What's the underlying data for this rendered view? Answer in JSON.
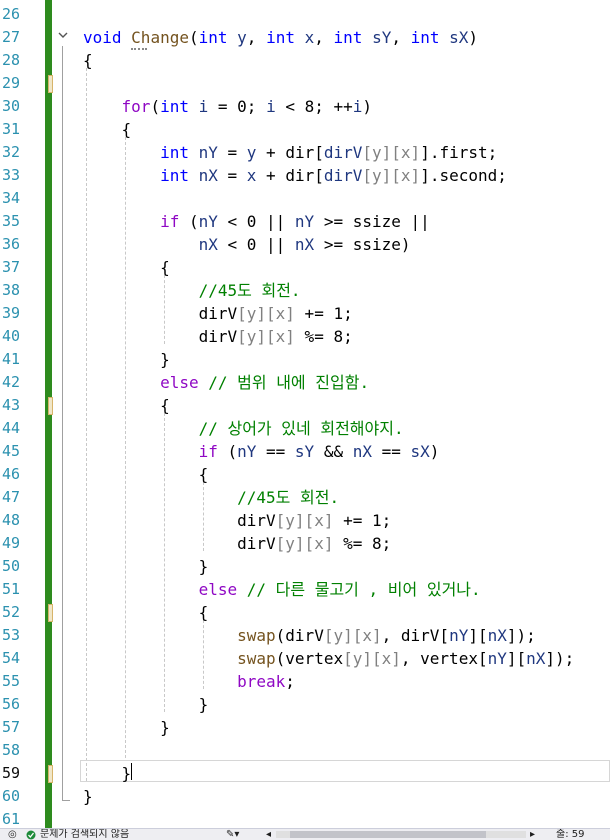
{
  "editor": {
    "current_line": "59",
    "lines": [
      {
        "num": "26",
        "segs": []
      },
      {
        "num": "27",
        "segs": [
          [
            "kw",
            "void"
          ],
          [
            "",
            " "
          ],
          [
            "fn",
            "Change"
          ],
          [
            "",
            "("
          ],
          [
            "kw",
            "int"
          ],
          [
            "",
            " "
          ],
          [
            "id",
            "y"
          ],
          [
            "",
            ", "
          ],
          [
            "kw",
            "int"
          ],
          [
            "",
            " "
          ],
          [
            "id",
            "x"
          ],
          [
            "",
            ", "
          ],
          [
            "kw",
            "int"
          ],
          [
            "",
            " "
          ],
          [
            "id",
            "sY"
          ],
          [
            "",
            ", "
          ],
          [
            "kw",
            "int"
          ],
          [
            "",
            " "
          ],
          [
            "id",
            "sX"
          ],
          [
            "",
            ")"
          ]
        ]
      },
      {
        "num": "28",
        "segs": [
          [
            "",
            "{"
          ]
        ]
      },
      {
        "num": "29",
        "segs": []
      },
      {
        "num": "30",
        "segs": [
          [
            "",
            "    "
          ],
          [
            "ctl",
            "for"
          ],
          [
            "",
            "("
          ],
          [
            "kw",
            "int"
          ],
          [
            "",
            " "
          ],
          [
            "id",
            "i"
          ],
          [
            "",
            " = 0; "
          ],
          [
            "id",
            "i"
          ],
          [
            "",
            " < 8; ++"
          ],
          [
            "id",
            "i"
          ],
          [
            "",
            ")"
          ]
        ]
      },
      {
        "num": "31",
        "segs": [
          [
            "",
            "    {"
          ]
        ]
      },
      {
        "num": "32",
        "segs": [
          [
            "",
            "        "
          ],
          [
            "kw",
            "int"
          ],
          [
            "",
            " "
          ],
          [
            "id",
            "nY"
          ],
          [
            "",
            " = "
          ],
          [
            "id",
            "y"
          ],
          [
            "",
            " + dir["
          ],
          [
            "id",
            "dirV"
          ],
          [
            "pr",
            "[y][x]"
          ],
          [
            "",
            "].first;"
          ]
        ]
      },
      {
        "num": "33",
        "segs": [
          [
            "",
            "        "
          ],
          [
            "kw",
            "int"
          ],
          [
            "",
            " "
          ],
          [
            "id",
            "nX"
          ],
          [
            "",
            " = "
          ],
          [
            "id",
            "x"
          ],
          [
            "",
            " + dir["
          ],
          [
            "id",
            "dirV"
          ],
          [
            "pr",
            "[y][x]"
          ],
          [
            "",
            "].second;"
          ]
        ]
      },
      {
        "num": "34",
        "segs": []
      },
      {
        "num": "35",
        "segs": [
          [
            "",
            "        "
          ],
          [
            "ctl",
            "if"
          ],
          [
            "",
            " ("
          ],
          [
            "id",
            "nY"
          ],
          [
            "",
            " < 0 || "
          ],
          [
            "id",
            "nY"
          ],
          [
            "",
            " >= ssize ||"
          ]
        ]
      },
      {
        "num": "36",
        "segs": [
          [
            "",
            "            "
          ],
          [
            "id",
            "nX"
          ],
          [
            "",
            " < 0 || "
          ],
          [
            "id",
            "nX"
          ],
          [
            "",
            " >= ssize)"
          ]
        ]
      },
      {
        "num": "37",
        "segs": [
          [
            "",
            "        {"
          ]
        ]
      },
      {
        "num": "38",
        "segs": [
          [
            "",
            "            "
          ],
          [
            "cm",
            "//45도 회전."
          ]
        ]
      },
      {
        "num": "39",
        "segs": [
          [
            "",
            "            dirV"
          ],
          [
            "pr",
            "[y][x]"
          ],
          [
            "",
            " += 1;"
          ]
        ]
      },
      {
        "num": "40",
        "segs": [
          [
            "",
            "            dirV"
          ],
          [
            "pr",
            "[y][x]"
          ],
          [
            "",
            " %= 8;"
          ]
        ]
      },
      {
        "num": "41",
        "segs": [
          [
            "",
            "        }"
          ]
        ]
      },
      {
        "num": "42",
        "segs": [
          [
            "",
            "        "
          ],
          [
            "ctl",
            "else"
          ],
          [
            "",
            " "
          ],
          [
            "cm",
            "// 범위 내에 진입함."
          ]
        ]
      },
      {
        "num": "43",
        "segs": [
          [
            "",
            "        {"
          ]
        ]
      },
      {
        "num": "44",
        "segs": [
          [
            "",
            "            "
          ],
          [
            "cm",
            "// 상어가 있네 회전해야지."
          ]
        ]
      },
      {
        "num": "45",
        "segs": [
          [
            "",
            "            "
          ],
          [
            "ctl",
            "if"
          ],
          [
            "",
            " ("
          ],
          [
            "id",
            "nY"
          ],
          [
            "",
            " == "
          ],
          [
            "id",
            "sY"
          ],
          [
            "",
            " && "
          ],
          [
            "id",
            "nX"
          ],
          [
            "",
            " == "
          ],
          [
            "id",
            "sX"
          ],
          [
            "",
            ")"
          ]
        ]
      },
      {
        "num": "46",
        "segs": [
          [
            "",
            "            {"
          ]
        ]
      },
      {
        "num": "47",
        "segs": [
          [
            "",
            "                "
          ],
          [
            "cm",
            "//45도 회전."
          ]
        ]
      },
      {
        "num": "48",
        "segs": [
          [
            "",
            "                dirV"
          ],
          [
            "pr",
            "[y][x]"
          ],
          [
            "",
            " += 1;"
          ]
        ]
      },
      {
        "num": "49",
        "segs": [
          [
            "",
            "                dirV"
          ],
          [
            "pr",
            "[y][x]"
          ],
          [
            "",
            " %= 8;"
          ]
        ]
      },
      {
        "num": "50",
        "segs": [
          [
            "",
            "            }"
          ]
        ]
      },
      {
        "num": "51",
        "segs": [
          [
            "",
            "            "
          ],
          [
            "ctl",
            "else"
          ],
          [
            "",
            " "
          ],
          [
            "cm",
            "// 다른 물고기 , 비어 있거나."
          ]
        ]
      },
      {
        "num": "52",
        "segs": [
          [
            "",
            "            {"
          ]
        ]
      },
      {
        "num": "53",
        "segs": [
          [
            "",
            "                "
          ],
          [
            "fn",
            "swap"
          ],
          [
            "",
            "(dirV"
          ],
          [
            "pr",
            "[y][x]"
          ],
          [
            "",
            ", dirV["
          ],
          [
            "id",
            "nY"
          ],
          [
            "",
            "]["
          ],
          [
            "id",
            "nX"
          ],
          [
            "",
            "]);"
          ]
        ]
      },
      {
        "num": "54",
        "segs": [
          [
            "",
            "                "
          ],
          [
            "fn",
            "swap"
          ],
          [
            "",
            "(vertex"
          ],
          [
            "pr",
            "[y][x]"
          ],
          [
            "",
            ", vertex["
          ],
          [
            "id",
            "nY"
          ],
          [
            "",
            "]["
          ],
          [
            "id",
            "nX"
          ],
          [
            "",
            "]);"
          ]
        ]
      },
      {
        "num": "55",
        "segs": [
          [
            "",
            "                "
          ],
          [
            "ctl",
            "break"
          ],
          [
            "",
            ";"
          ]
        ]
      },
      {
        "num": "56",
        "segs": [
          [
            "",
            "            }"
          ]
        ]
      },
      {
        "num": "57",
        "segs": [
          [
            "",
            "        }"
          ]
        ]
      },
      {
        "num": "58",
        "segs": []
      },
      {
        "num": "59",
        "segs": [
          [
            "",
            "    }"
          ]
        ]
      },
      {
        "num": "60",
        "segs": [
          [
            "",
            "}"
          ]
        ]
      },
      {
        "num": "61",
        "segs": []
      }
    ]
  },
  "statusbar": {
    "issues_text": "문제가 검색되지 않음",
    "line_label": "줄: 59"
  },
  "colors": {
    "keyword": "#0000ff",
    "control": "#8f08c4",
    "comment": "#008000",
    "identifier": "#1f377f",
    "function": "#74531f",
    "line_number": "#2b91af",
    "change_bar": "#2e8b1e"
  }
}
